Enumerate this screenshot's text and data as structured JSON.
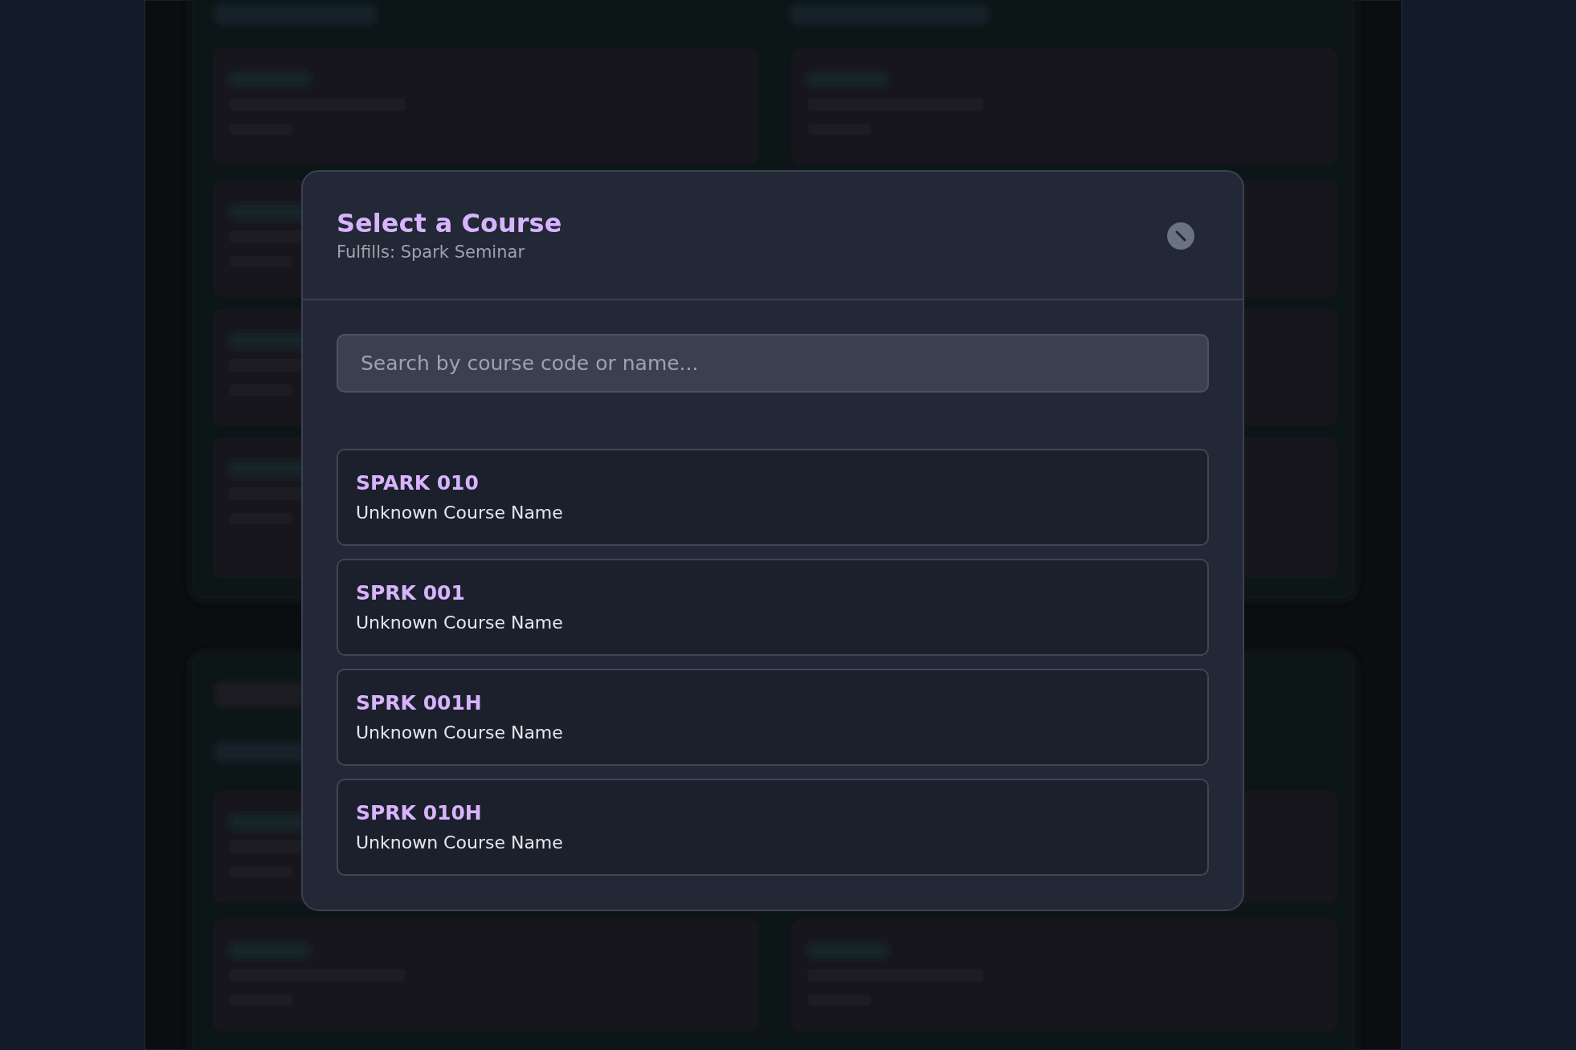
{
  "dialog": {
    "title": "Select a Course",
    "subtitle": "Fulfills: Spark Seminar",
    "search": {
      "placeholder": "Search by course code or name..."
    },
    "courses": [
      {
        "code": "SPARK 010",
        "name": "Unknown Course Name"
      },
      {
        "code": "SPRK 001",
        "name": "Unknown Course Name"
      },
      {
        "code": "SPRK 001H",
        "name": "Unknown Course Name"
      },
      {
        "code": "SPRK 010H",
        "name": "Unknown Course Name"
      }
    ]
  }
}
